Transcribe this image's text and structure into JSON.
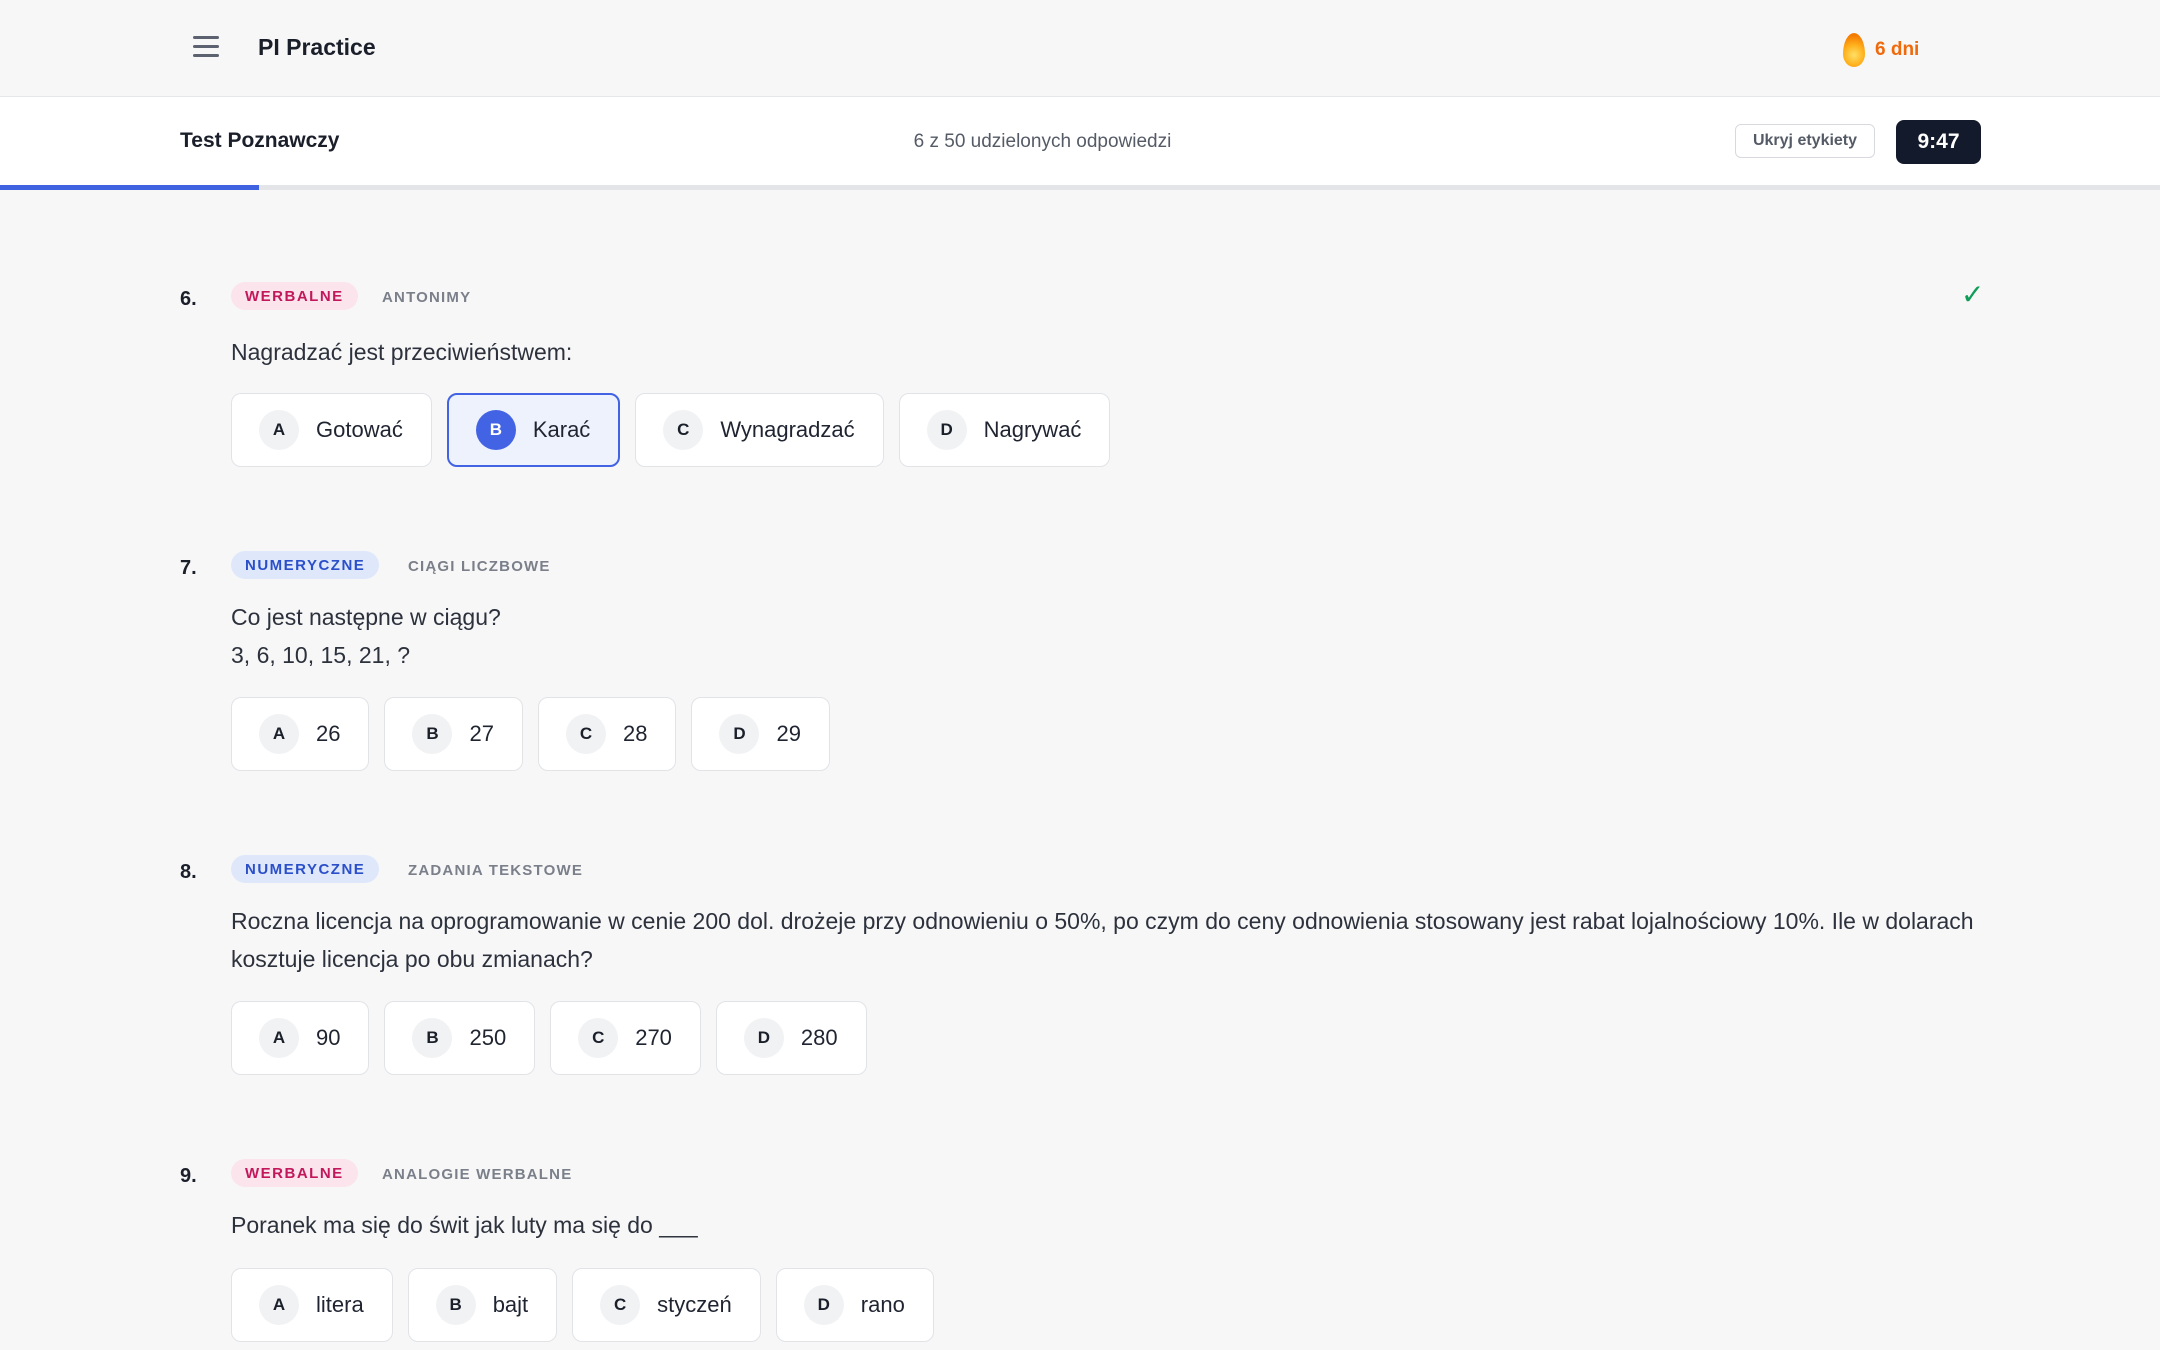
{
  "app": {
    "title": "PI Practice",
    "streak": "6 dni"
  },
  "test": {
    "title": "Test Poznawczy",
    "answered": "6 z 50 udzielonych odpowiedzi",
    "hide_labels": "Ukryj etykiety",
    "timer": "9:47",
    "progress_fraction": 0.12
  },
  "colors": {
    "accent": "#4263e3",
    "verbal": "#c2185b",
    "numeric": "#2a4fc9",
    "timer_bg": "#131a2b",
    "streak": "#ef6a0c"
  },
  "questions": [
    {
      "number": "6.",
      "category": "WERBALNE",
      "subcategory": "ANTONIMY",
      "answered": true,
      "text": "Nagradzać jest przeciwieństwem:",
      "text2": "",
      "options": [
        {
          "letter": "A",
          "text": "Gotować"
        },
        {
          "letter": "B",
          "text": "Karać",
          "selected": true
        },
        {
          "letter": "C",
          "text": "Wynagradzać"
        },
        {
          "letter": "D",
          "text": "Nagrywać"
        }
      ]
    },
    {
      "number": "7.",
      "category": "NUMERYCZNE",
      "subcategory": "CIĄGI LICZBOWE",
      "answered": false,
      "text": "Co jest następne w ciągu?",
      "text2": "3, 6, 10, 15, 21, ?",
      "options": [
        {
          "letter": "A",
          "text": "26"
        },
        {
          "letter": "B",
          "text": "27"
        },
        {
          "letter": "C",
          "text": "28"
        },
        {
          "letter": "D",
          "text": "29"
        }
      ]
    },
    {
      "number": "8.",
      "category": "NUMERYCZNE",
      "subcategory": "ZADANIA TEKSTOWE",
      "answered": false,
      "text": "Roczna licencja na oprogramowanie w cenie 200 dol. drożeje przy odnowieniu o 50%, po czym do ceny odnowienia stosowany jest rabat lojalnościowy 10%. Ile w dolarach kosztuje licencja po obu zmianach?",
      "text2": "",
      "options": [
        {
          "letter": "A",
          "text": "90"
        },
        {
          "letter": "B",
          "text": "250"
        },
        {
          "letter": "C",
          "text": "270"
        },
        {
          "letter": "D",
          "text": "280"
        }
      ]
    },
    {
      "number": "9.",
      "category": "WERBALNE",
      "subcategory": "ANALOGIE WERBALNE",
      "answered": false,
      "text": "Poranek ma się do świt jak luty ma się do ___",
      "text2": "",
      "options": [
        {
          "letter": "A",
          "text": "litera"
        },
        {
          "letter": "B",
          "text": "bajt"
        },
        {
          "letter": "C",
          "text": "styczeń"
        },
        {
          "letter": "D",
          "text": "rano"
        }
      ]
    }
  ]
}
